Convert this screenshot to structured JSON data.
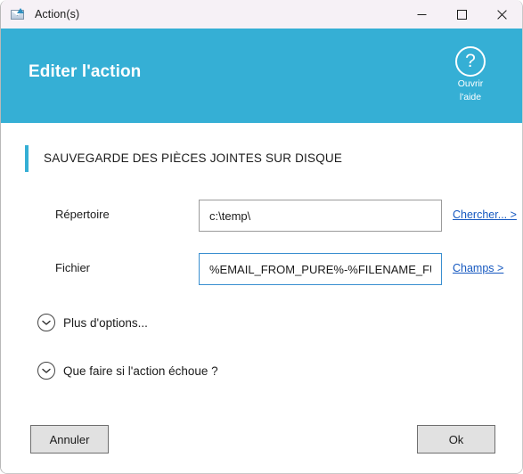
{
  "window": {
    "title": "Action(s)",
    "icon": "mail-save-icon",
    "controls": {
      "minimize": "minimize-icon",
      "maximize": "maximize-icon",
      "close": "close-icon"
    }
  },
  "header": {
    "title": "Editer l'action",
    "accent_color": "#35afd5",
    "help": {
      "icon": "question-mark-icon",
      "symbol": "?",
      "line1": "Ouvrir",
      "line2": "l'aide"
    }
  },
  "section": {
    "title": "SAUVEGARDE DES PIÈCES JOINTES SUR DISQUE",
    "accent_color": "#35afd5"
  },
  "form": {
    "rows": [
      {
        "label": "Répertoire",
        "value": "c:\\temp\\",
        "placeholder": "",
        "link": "Chercher... >",
        "focused": false
      },
      {
        "label": "Fichier",
        "value": "%EMAIL_FROM_PURE%-%FILENAME_FULL%",
        "placeholder": "",
        "link": "Champs >",
        "focused": true
      }
    ],
    "link_color": "#1558c0"
  },
  "expanders": [
    {
      "label": "Plus d'options...",
      "icon": "chevron-down-icon",
      "expanded": false
    },
    {
      "label": "Que faire si l'action échoue ?",
      "icon": "chevron-down-icon",
      "expanded": false
    }
  ],
  "footer": {
    "cancel_label": "Annuler",
    "ok_label": "Ok"
  }
}
